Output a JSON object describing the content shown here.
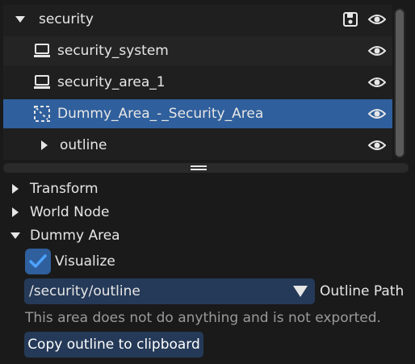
{
  "tree": {
    "root": {
      "label": "security",
      "expanded": true
    },
    "items": [
      {
        "label": "security_system",
        "icon": "node-computer-icon"
      },
      {
        "label": "security_area_1",
        "icon": "node-computer-icon"
      },
      {
        "label": "Dummy_Area_-_Security_Area",
        "icon": "dashed-area-icon",
        "selected": true
      },
      {
        "label": "outline",
        "icon": "expand-arrow-icon",
        "expanded": false
      }
    ]
  },
  "inspector": {
    "sections": [
      {
        "label": "Transform",
        "expanded": false
      },
      {
        "label": "World Node",
        "expanded": false
      },
      {
        "label": "Dummy Area",
        "expanded": true
      }
    ],
    "visualize": {
      "label": "Visualize",
      "checked": true
    },
    "outline_path": {
      "value": "/security/outline",
      "label": "Outline Path"
    },
    "note": "This area does not do anything and is not exported.",
    "copy_button": "Copy outline to clipboard"
  },
  "colors": {
    "selection": "#2f5f9c",
    "field_bg": "#253a58",
    "background": "#1a1a1a"
  }
}
